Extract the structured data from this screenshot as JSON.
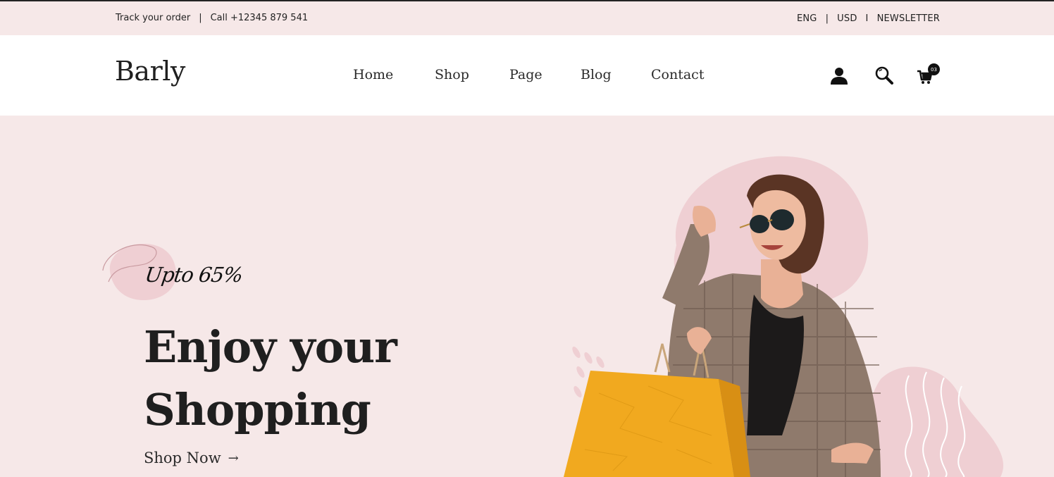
{
  "topbar": {
    "track": "Track your order",
    "sep1": "|",
    "call": "Call +12345 879 541",
    "lang": "ENG",
    "sep2": "|",
    "currency": "USD",
    "sep3": "I",
    "newsletter": "NEWSLETTER"
  },
  "header": {
    "logo": "Barly",
    "nav": {
      "home": "Home",
      "shop": "Shop",
      "page": "Page",
      "blog": "Blog",
      "contact": "Contact"
    },
    "cart_count": "03",
    "icons": {
      "user": "user-icon",
      "search": "search-icon",
      "cart": "cart-icon"
    }
  },
  "hero": {
    "tagline": "Upto 65%",
    "headline_line1": "Enjoy your",
    "headline_line2": "Shopping",
    "cta": "Shop Now",
    "cta_arrow": "→"
  },
  "colors": {
    "background": "#f6e8e8",
    "header_bg": "#ffffff",
    "accent_blob": "#efcfd3",
    "bag": "#f1a91f",
    "text": "#1f1f1f"
  }
}
